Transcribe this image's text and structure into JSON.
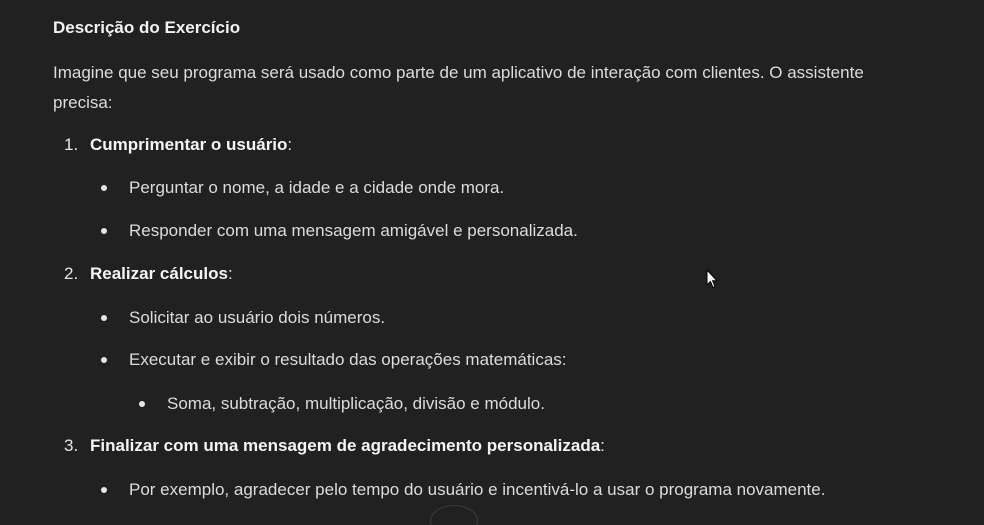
{
  "heading": "Descrição do Exercício",
  "intro": "Imagine que seu programa será usado como parte de um aplicativo de interação com clientes. O assistente precisa:",
  "steps": [
    {
      "number": "1.",
      "title": "Cumprimentar o usuário",
      "suffix": ":",
      "bullets": [
        "Perguntar o nome, a idade e a cidade onde mora.",
        "Responder com uma mensagem amigável e personalizada."
      ]
    },
    {
      "number": "2.",
      "title": "Realizar cálculos",
      "suffix": ":",
      "bullets": [
        "Solicitar ao usuário dois números.",
        "Executar e exibir o resultado das operações matemáticas:"
      ],
      "sub_bullets": [
        "Soma, subtração, multiplicação, divisão e módulo."
      ]
    },
    {
      "number": "3.",
      "title": "Finalizar com uma mensagem de agradecimento personalizada",
      "suffix": ":",
      "bullets": [
        "Por exemplo, agradecer pelo tempo do usuário e incentivá-lo a usar o programa novamente."
      ]
    }
  ],
  "cursor_icon": "mouse-pointer-icon"
}
